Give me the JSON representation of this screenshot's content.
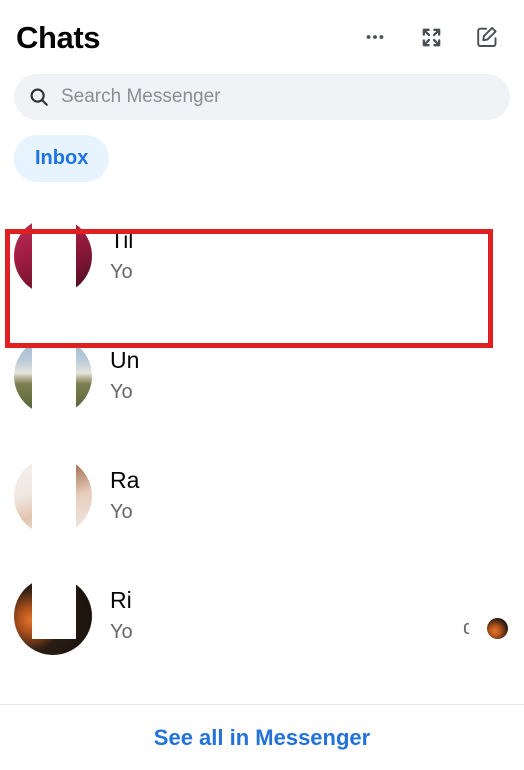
{
  "header": {
    "title": "Chats",
    "actions": [
      {
        "name": "more-options-button",
        "icon": "ellipsis-icon",
        "label": "Options"
      },
      {
        "name": "expand-button",
        "icon": "expand-icon",
        "label": "Expand"
      },
      {
        "name": "new-message-button",
        "icon": "compose-icon",
        "label": "New message"
      }
    ]
  },
  "search": {
    "placeholder": "Search Messenger",
    "value": "",
    "icon": "search-icon"
  },
  "filters": {
    "items": [
      {
        "label": "Inbox",
        "active": true
      }
    ]
  },
  "chats": [
    {
      "name": "Til",
      "preview": "Yo",
      "avatar_colors": [
        "#a51e42",
        "#7e1535",
        "#4a0d20"
      ],
      "avatar_style": "crescents",
      "highlighted": true,
      "trailing_glyph": "",
      "read_receipt": false
    },
    {
      "name": "Un",
      "preview": "Yo",
      "avatar_colors": [
        "#9db7cd",
        "#e8e4dc",
        "#4e5f30"
      ],
      "avatar_style": "crescents",
      "highlighted": false,
      "trailing_glyph": "",
      "read_receipt": false
    },
    {
      "name": "Ra",
      "preview": "Yo",
      "avatar_colors": [
        "#f2ece8",
        "#e2c3ae",
        "#c79a7e"
      ],
      "avatar_style": "crescents",
      "highlighted": false,
      "trailing_glyph": "",
      "read_receipt": false
    },
    {
      "name": "Ri",
      "preview": "Yo",
      "avatar_colors": [
        "#1c1410",
        "#e3752c",
        "#241a14"
      ],
      "avatar_style": "ring",
      "highlighted": false,
      "trailing_glyph": "d",
      "read_receipt": true,
      "read_receipt_colors": [
        "#241a12",
        "#e0762e"
      ]
    }
  ],
  "footer": {
    "link_label": "See all in Messenger"
  },
  "annotation": {
    "color": "#e02020",
    "target": "chat-row-0"
  },
  "colors": {
    "accent_blue": "#1b74e2",
    "link_blue": "#2272d9",
    "pill_bg": "#e7f3ff",
    "search_bg": "#f0f2f5",
    "text_primary": "#050505",
    "text_secondary": "#65676b",
    "annotation_red": "#e02020"
  }
}
